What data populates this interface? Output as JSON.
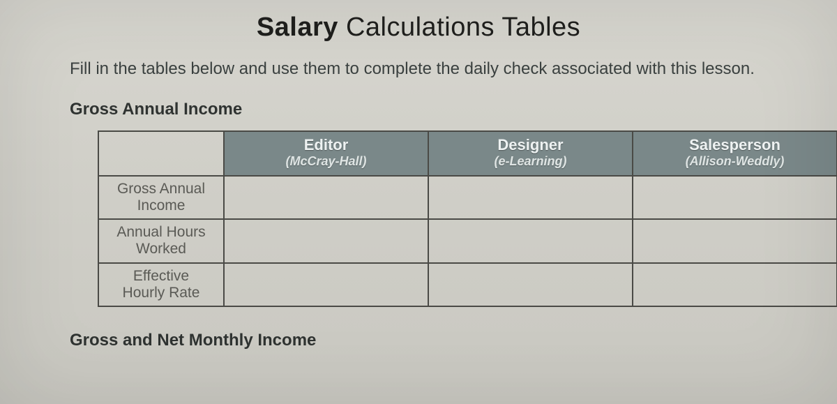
{
  "title_bold": "Salary",
  "title_rest": " Calculations Tables",
  "instructions": "Fill in the tables below and use them to complete the daily check associated with this lesson.",
  "section1_heading": "Gross Annual Income",
  "section2_heading": "Gross and Net Monthly Income",
  "table1": {
    "columns": [
      {
        "title": "Editor",
        "subtitle": "(McCray-Hall)"
      },
      {
        "title": "Designer",
        "subtitle": "(e-Learning)"
      },
      {
        "title": "Salesperson",
        "subtitle": "(Allison-Weddly)"
      }
    ],
    "rows": [
      {
        "label_line1": "Gross Annual",
        "label_line2": "Income",
        "cells": [
          "",
          "",
          ""
        ]
      },
      {
        "label_line1": "Annual Hours",
        "label_line2": "Worked",
        "cells": [
          "",
          "",
          ""
        ]
      },
      {
        "label_line1": "Effective",
        "label_line2": "Hourly Rate",
        "cells": [
          "",
          "",
          ""
        ]
      }
    ]
  }
}
